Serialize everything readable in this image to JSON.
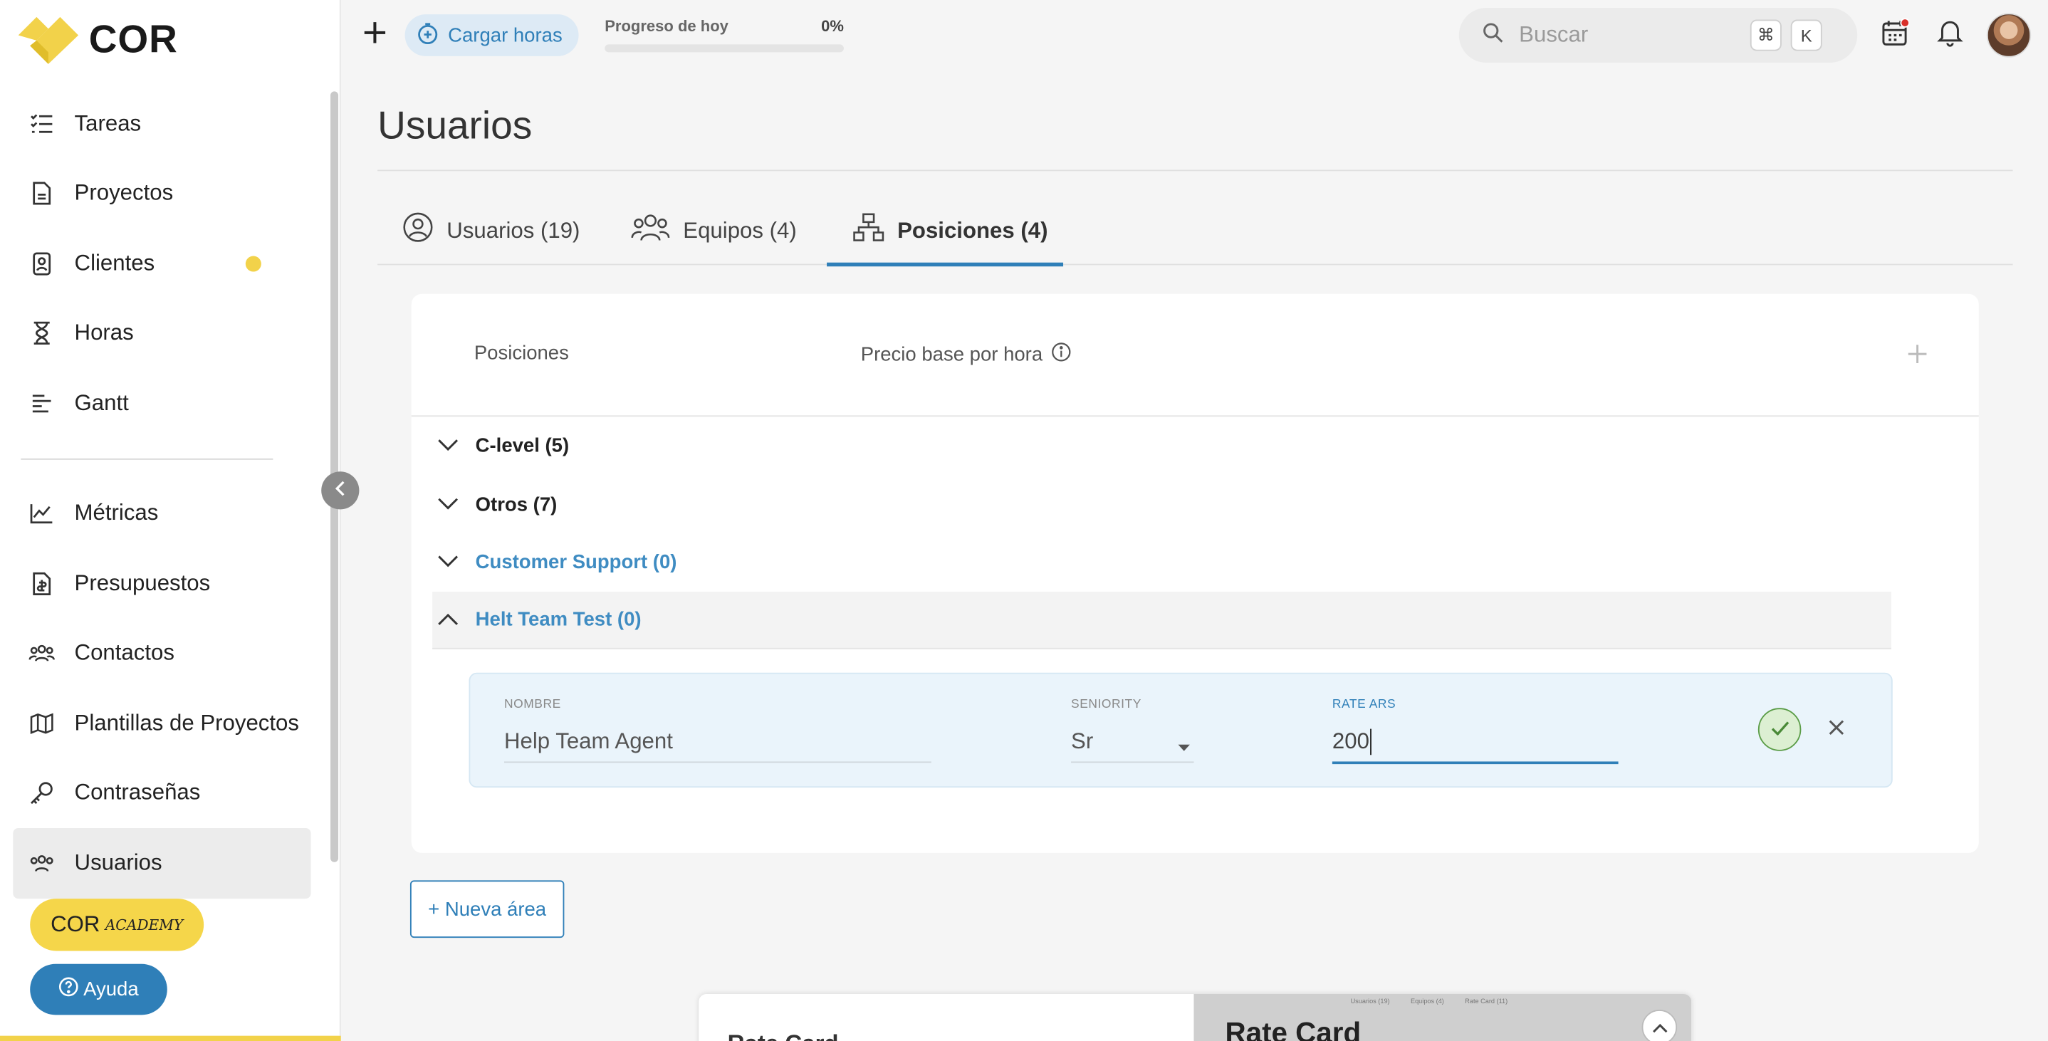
{
  "brand": {
    "name": "COR",
    "accent": "#2f7fb8",
    "yellow": "#f2d24a"
  },
  "sidebar": {
    "items": [
      {
        "label": "Tareas",
        "icon": "checklist-icon"
      },
      {
        "label": "Proyectos",
        "icon": "document-icon"
      },
      {
        "label": "Clientes",
        "icon": "client-card-icon",
        "badge": true
      },
      {
        "label": "Horas",
        "icon": "hourglass-icon"
      },
      {
        "label": "Gantt",
        "icon": "gantt-icon"
      }
    ],
    "items2": [
      {
        "label": "Métricas",
        "icon": "chart-icon"
      },
      {
        "label": "Presupuestos",
        "icon": "budget-icon"
      },
      {
        "label": "Contactos",
        "icon": "contacts-icon"
      },
      {
        "label": "Plantillas de Proyectos",
        "icon": "map-icon"
      },
      {
        "label": "Contraseñas",
        "icon": "key-icon"
      },
      {
        "label": "Usuarios",
        "icon": "users-icon",
        "active": true
      }
    ],
    "academy_label": "COR",
    "academy_script": "ACADEMY",
    "help_label": "Ayuda"
  },
  "topbar": {
    "cargar_label": "Cargar horas",
    "progress_label": "Progreso de hoy",
    "progress_pct": "0%",
    "progress_value": 0,
    "search_placeholder": "Buscar",
    "shortcut_cmd": "⌘",
    "shortcut_key": "K"
  },
  "page": {
    "title": "Usuarios",
    "tabs": [
      {
        "label": "Usuarios (19)",
        "icon": "user-circle-icon"
      },
      {
        "label": "Equipos (4)",
        "icon": "team-icon"
      },
      {
        "label": "Posiciones (4)",
        "icon": "org-chart-icon",
        "active": true
      }
    ]
  },
  "positions": {
    "col_positions": "Posiciones",
    "col_price": "Precio base por hora",
    "groups": [
      {
        "label": "C-level (5)",
        "expanded": false,
        "highlight": false
      },
      {
        "label": "Otros (7)",
        "expanded": false,
        "highlight": false
      },
      {
        "label": "Customer Support (0)",
        "expanded": false,
        "highlight": true
      },
      {
        "label": "Helt Team Test (0)",
        "expanded": true,
        "highlight": true
      }
    ],
    "edit": {
      "name_label": "NOMBRE",
      "name_value": "Help Team Agent",
      "seniority_label": "SENIORITY",
      "seniority_value": "Sr",
      "rate_label": "RATE ARS",
      "rate_value": "200"
    },
    "new_area_label": "+ Nueva área"
  },
  "preview": {
    "left_title": "Rate Card",
    "right_title": "Rate Card",
    "mini_tabs": [
      "Usuarios (19)",
      "Equipos (4)",
      "Rate Card (11)"
    ]
  }
}
